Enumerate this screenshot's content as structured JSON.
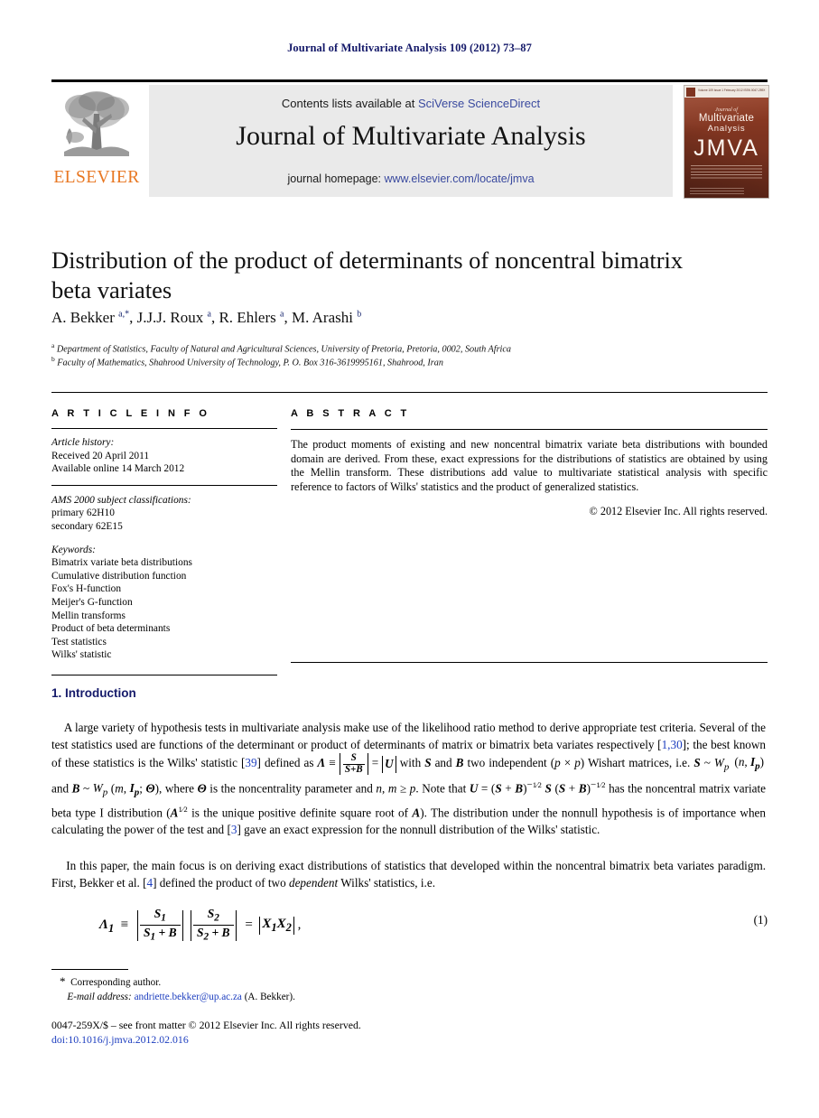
{
  "running_head": "Journal of Multivariate Analysis 109 (2012) 73–87",
  "masthead": {
    "contents_prefix": "Contents lists available at ",
    "contents_link": "SciVerse ScienceDirect",
    "journal_title": "Journal of Multivariate Analysis",
    "homepage_prefix": "journal homepage: ",
    "homepage_link": "www.elsevier.com/locate/jmva",
    "publisher_wordmark": "ELSEVIER",
    "cover": {
      "masthead_small": "Volume 109   Issue 1   February 2012   ISSN 0047-259X",
      "journal_of": "Journal of",
      "line_multivariate": "Multivariate",
      "line_analysis": "Analysis",
      "acronym": "JMVA"
    }
  },
  "article": {
    "title": "Distribution of the product of determinants of noncentral bimatrix beta variates",
    "authors_html": "A. Bekker <sup>a,*</sup>, J.J.J. Roux <sup>a</sup>, R. Ehlers <sup>a</sup>, M. Arashi <sup>b</sup>",
    "affiliation_a": "Department of Statistics, Faculty of Natural and Agricultural Sciences, University of Pretoria, Pretoria, 0002, South Africa",
    "affiliation_b": "Faculty of Mathematics, Shahrood University of Technology, P. O. Box 316-3619995161, Shahrood, Iran",
    "affiliation_a_marker": "a",
    "affiliation_b_marker": "b"
  },
  "info": {
    "heading": "A R T I C L E    I N F O",
    "history_label": "Article history:",
    "history": [
      "Received 20 April 2011",
      "Available online 14 March 2012"
    ],
    "msc_label": "AMS 2000 subject classifications:",
    "msc": [
      "primary 62H10",
      "secondary 62E15"
    ],
    "keywords_label": "Keywords:",
    "keywords": [
      "Bimatrix variate beta distributions",
      "Cumulative distribution function",
      "Fox's H-function",
      "Meijer's G-function",
      "Mellin transforms",
      "Product of beta determinants",
      "Test statistics",
      "Wilks' statistic"
    ]
  },
  "abstract": {
    "heading": "A B S T R A C T",
    "text": "The product moments of existing and new noncentral bimatrix variate beta distributions with bounded domain are derived. From these, exact expressions for the distributions of statistics are obtained by using the Mellin transform. These distributions add value to multivariate statistical analysis with specific reference to factors of Wilks' statistics and the product of generalized statistics.",
    "copyright": "© 2012 Elsevier Inc. All rights reserved."
  },
  "body": {
    "section_number_title": "1. Introduction",
    "equation_number": "(1)"
  },
  "footnote": {
    "corresponding": "Corresponding author.",
    "email_label": "E-mail address:",
    "email": "andriette.bekker@up.ac.za",
    "email_suffix": "(A. Bekker)."
  },
  "imprint": {
    "line1": "0047-259X/$ – see front matter © 2012 Elsevier Inc. All rights reserved.",
    "doi": "doi:10.1016/j.jmva.2012.02.016"
  },
  "colors": {
    "link": "#3a4a9f",
    "reference": "#1d3ebf",
    "elsevier_orange": "#E87722",
    "running_head": "#151a6a",
    "banner_bg": "#eaeaea",
    "cover_bg": "#8a3b23"
  }
}
